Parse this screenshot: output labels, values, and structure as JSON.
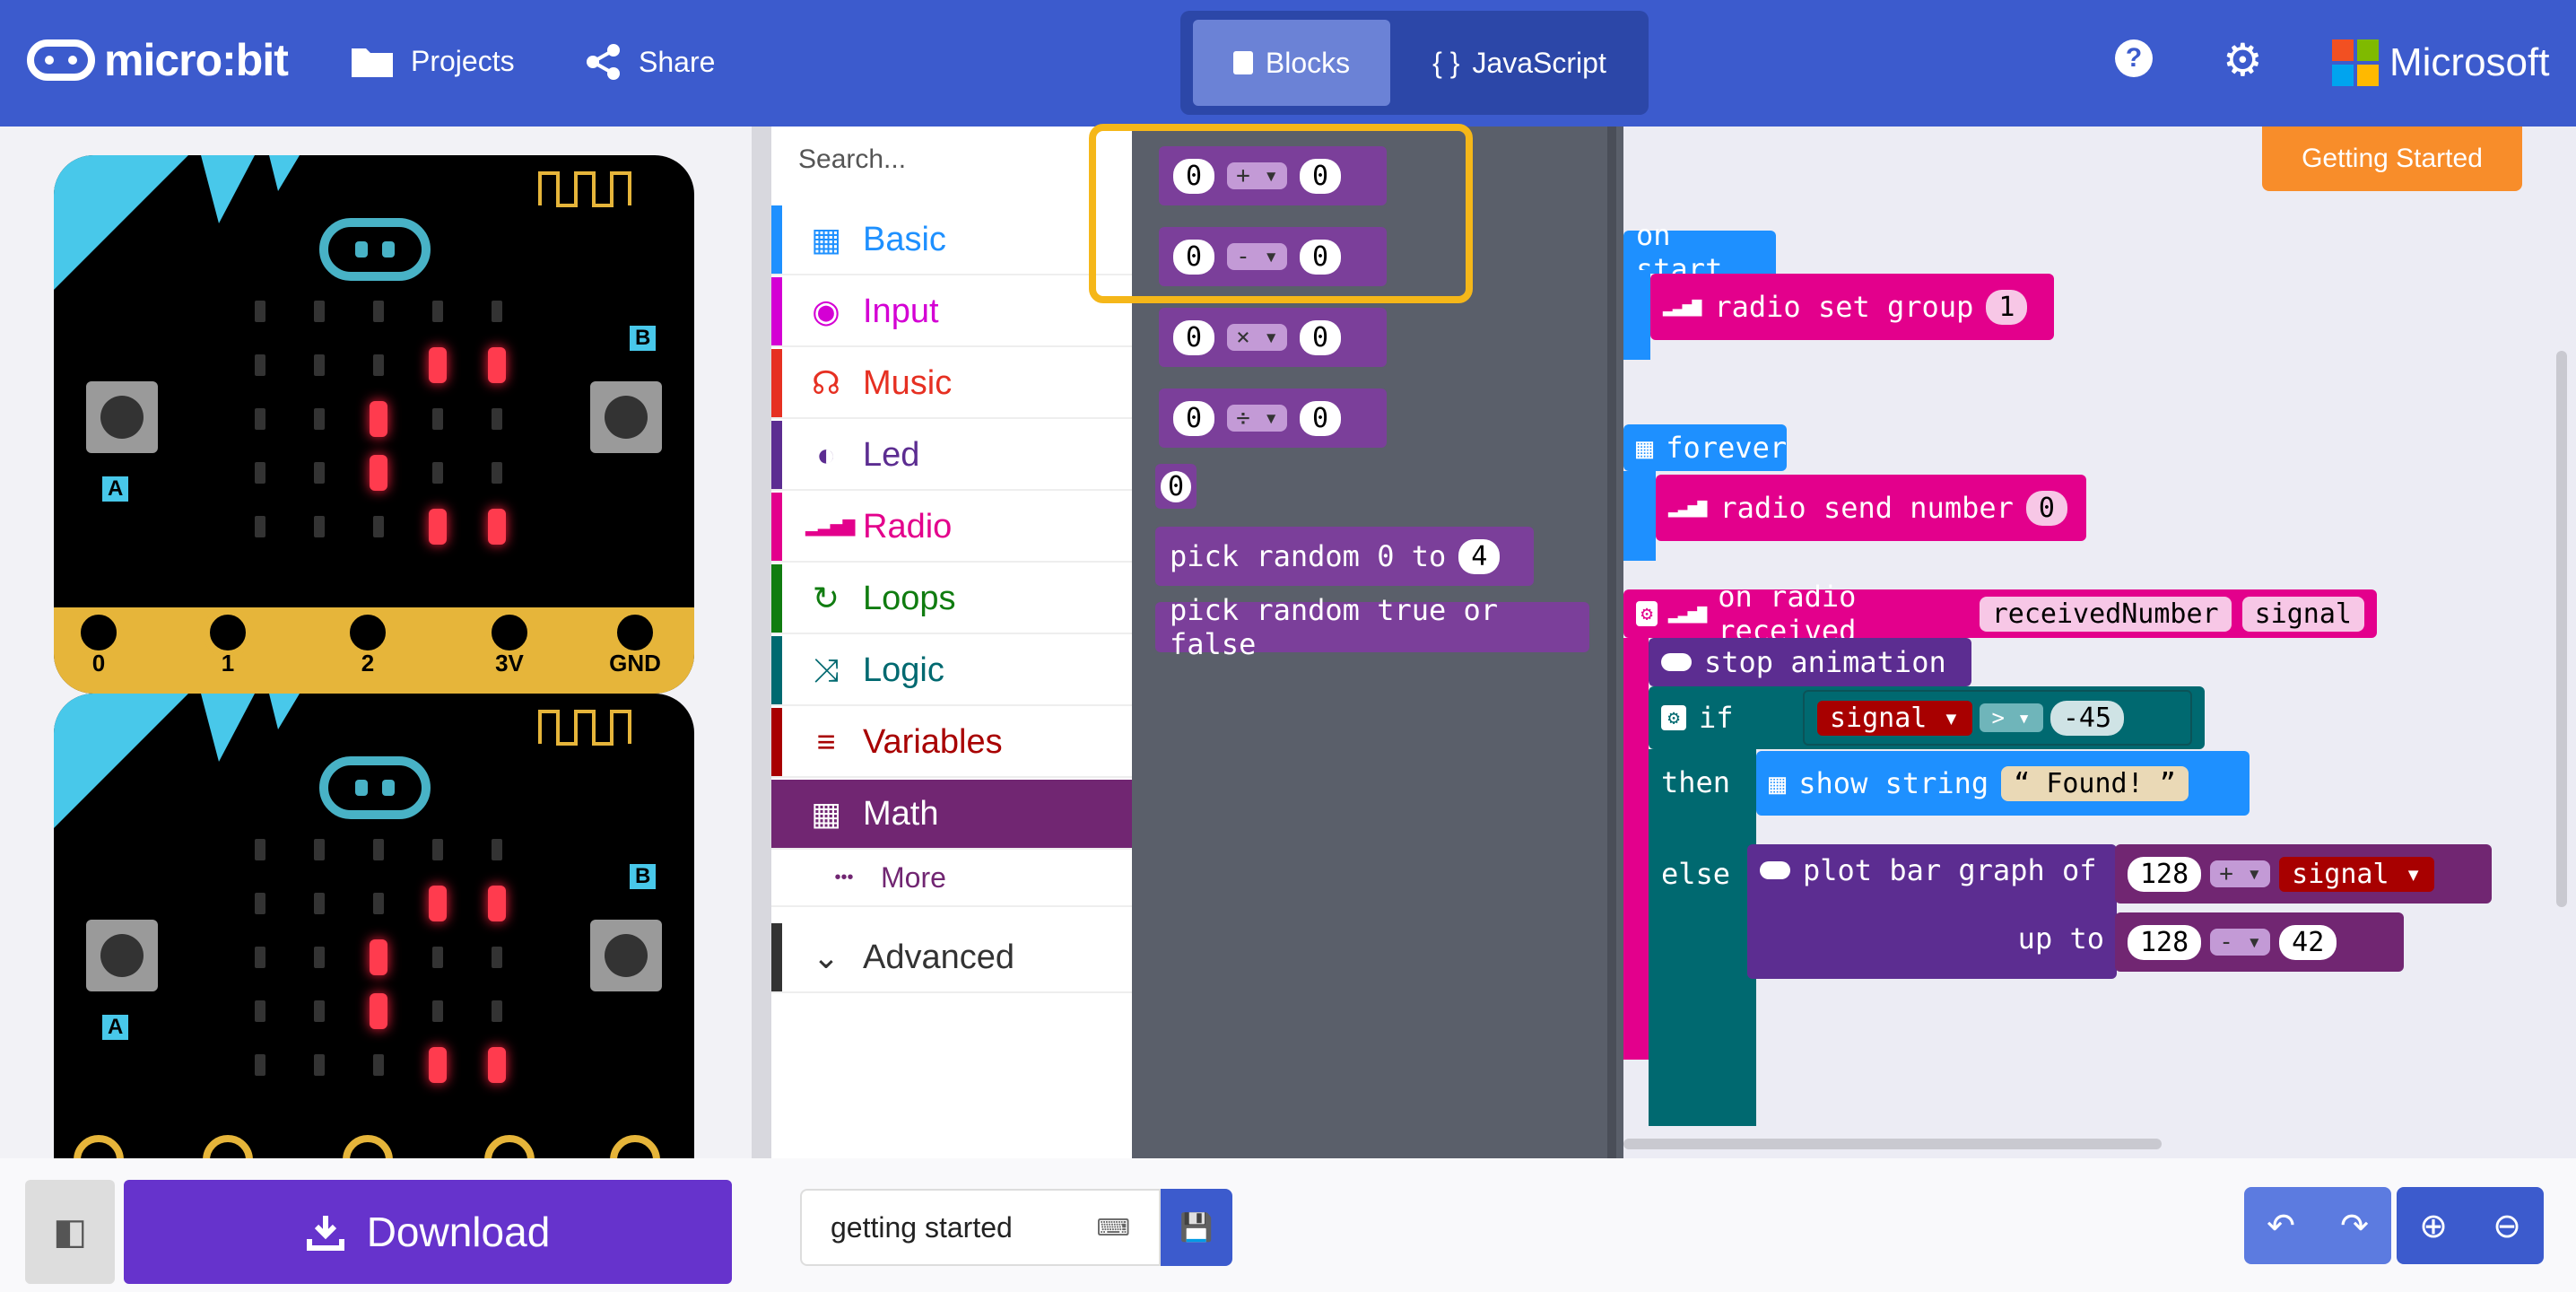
{
  "header": {
    "logo_text": "micro:bit",
    "projects_label": "Projects",
    "share_label": "Share",
    "mode_blocks": "Blocks",
    "mode_js": "JavaScript",
    "mode_js_icon": "{ }",
    "help_icon": "?",
    "settings_icon": "⚙",
    "brand": "Microsoft"
  },
  "simulator": {
    "pin_labels": [
      "0",
      "1",
      "2",
      "3V",
      "GND"
    ],
    "button_a": "A",
    "button_b": "B"
  },
  "toolbox": {
    "search_placeholder": "Search...",
    "categories": [
      {
        "label": "Basic",
        "icon": "▦",
        "color": "#1e90ff"
      },
      {
        "label": "Input",
        "icon": "◉",
        "color": "#d400d4"
      },
      {
        "label": "Music",
        "icon": "☊",
        "color": "#e63022"
      },
      {
        "label": "Led",
        "icon": "◐",
        "color": "#5c2d91"
      },
      {
        "label": "Radio",
        "icon": "▂▃▅▇",
        "color": "#e3008c"
      },
      {
        "label": "Loops",
        "icon": "↻",
        "color": "#107c10"
      },
      {
        "label": "Logic",
        "icon": "⤨",
        "color": "#006970"
      },
      {
        "label": "Variables",
        "icon": "≡",
        "color": "#a80000"
      },
      {
        "label": "Math",
        "icon": "▦",
        "color": "#712672"
      }
    ],
    "more_label": "More",
    "more_icon": "•••",
    "advanced_label": "Advanced",
    "advanced_icon": "⌄"
  },
  "flyout": {
    "blocks": [
      {
        "left": "0",
        "op": "+ ▾",
        "right": "0"
      },
      {
        "left": "0",
        "op": "- ▾",
        "right": "0"
      },
      {
        "left": "0",
        "op": "× ▾",
        "right": "0"
      },
      {
        "left": "0",
        "op": "÷ ▾",
        "right": "0"
      }
    ],
    "zero": "0",
    "random_label": "pick random 0 to",
    "random_max": "4",
    "random_bool": "pick random true or false"
  },
  "workspace": {
    "getting_started": "Getting Started",
    "on_start": "on start",
    "radio_set_group": "radio set group",
    "group_value": "1",
    "forever": "forever",
    "radio_send_number": "radio send number",
    "send_value": "0",
    "on_radio_received": "on radio received",
    "param_received": "receivedNumber",
    "param_signal": "signal",
    "stop_animation": "stop animation",
    "if_label": "if",
    "cond_var": "signal ▾",
    "cond_op": "> ▾",
    "cond_value": "-45",
    "then_label": "then",
    "show_string": "show string",
    "string_value": "Found!",
    "else_label": "else",
    "plot_bar_graph": "plot bar graph of",
    "plot_value": "128",
    "plot_op": "+ ▾",
    "plot_var": "signal ▾",
    "up_to": "up to",
    "upto_value": "128",
    "upto_op": "- ▾",
    "upto_right": "42"
  },
  "bottom": {
    "download_label": "Download",
    "project_name": "getting started"
  }
}
